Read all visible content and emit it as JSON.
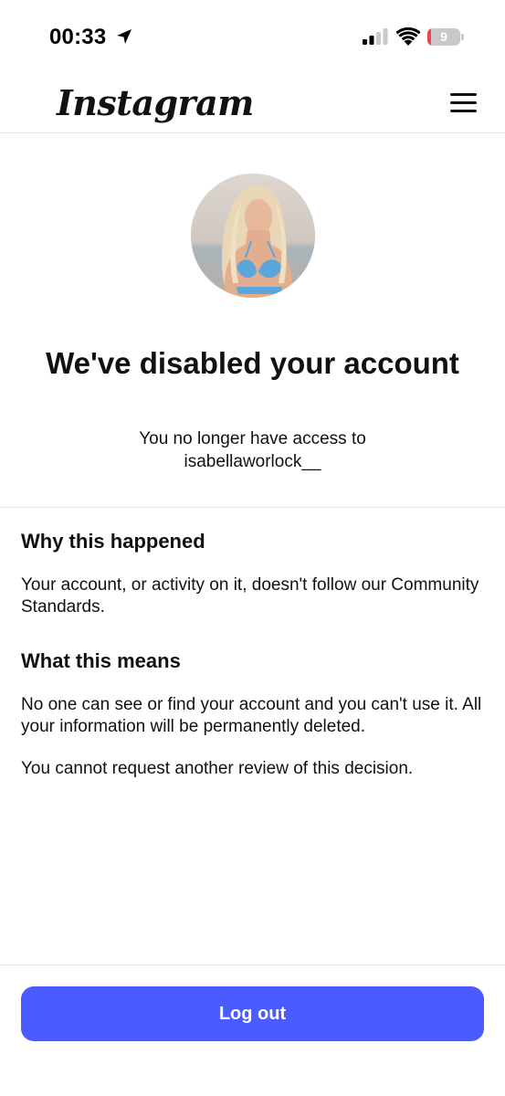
{
  "status_bar": {
    "time": "00:33",
    "battery_level": "9",
    "battery_fraction": 0.09,
    "location_icon": "location-arrow-icon",
    "signal_icon": "cellular-signal-icon",
    "wifi_icon": "wifi-icon"
  },
  "header": {
    "logo_text": "Instagram",
    "menu_icon": "hamburger-menu-icon"
  },
  "profile": {
    "title": "We've disabled your account",
    "subtitle_line1": "You no longer have access to",
    "username": "isabellaworlock__"
  },
  "why": {
    "heading": "Why this happened",
    "text": "Your account, or activity on it, doesn't follow our Community Standards."
  },
  "means": {
    "heading": "What this means",
    "text1": "No one can see or find your account and you can't use it. All your information will be permanently deleted.",
    "text2": "You cannot request another review of this decision."
  },
  "actions": {
    "logout_label": "Log out"
  },
  "colors": {
    "primary_button": "#4a5cff",
    "battery_low": "#e5484d",
    "divider": "#e4e4e7"
  }
}
